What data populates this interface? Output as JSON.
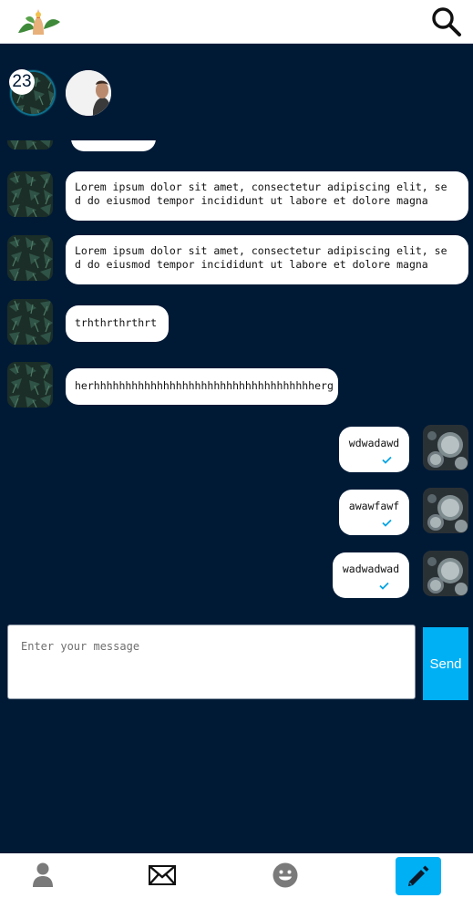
{
  "header": {
    "logo_icon": "plant-hand-logo",
    "search_icon": "search-icon"
  },
  "contacts": {
    "unread_count": "23",
    "items": [
      {
        "avatar": "foliage-avatar",
        "active": true
      },
      {
        "avatar": "person-avatar",
        "active": false
      }
    ]
  },
  "messages": [
    {
      "direction": "in",
      "text": "Lorem ipsum dolor sit amet, consectetur adipiscing elit, se",
      "text2": "d do eiusmod tempor incididunt ut labore et dolore magna"
    },
    {
      "direction": "in",
      "text": "Lorem ipsum dolor sit amet, consectetur adipiscing elit, se",
      "text2": "d do eiusmod tempor incididunt ut labore et dolore magna"
    },
    {
      "direction": "in",
      "text": "trhthrthrthrt"
    },
    {
      "direction": "in",
      "text": "herhhhhhhhhhhhhhhhhhhhhhhhhhhhhhhhhhhherg"
    },
    {
      "direction": "out",
      "text": "wdwadawd",
      "read": true
    },
    {
      "direction": "out",
      "text": "awawfawf",
      "read": true
    },
    {
      "direction": "out",
      "text": "wadwadwad",
      "read": true
    }
  ],
  "composer": {
    "placeholder": "Enter your message",
    "value": "",
    "send_label": "Send"
  },
  "bottom_nav": [
    {
      "icon": "profile-icon",
      "active": false
    },
    {
      "icon": "envelope-icon",
      "active": false
    },
    {
      "icon": "smiley-icon",
      "active": false
    },
    {
      "icon": "pencil-icon",
      "active": true
    }
  ],
  "colors": {
    "background": "#001a36",
    "accent": "#00b0f5",
    "bubble": "#ffffff"
  }
}
